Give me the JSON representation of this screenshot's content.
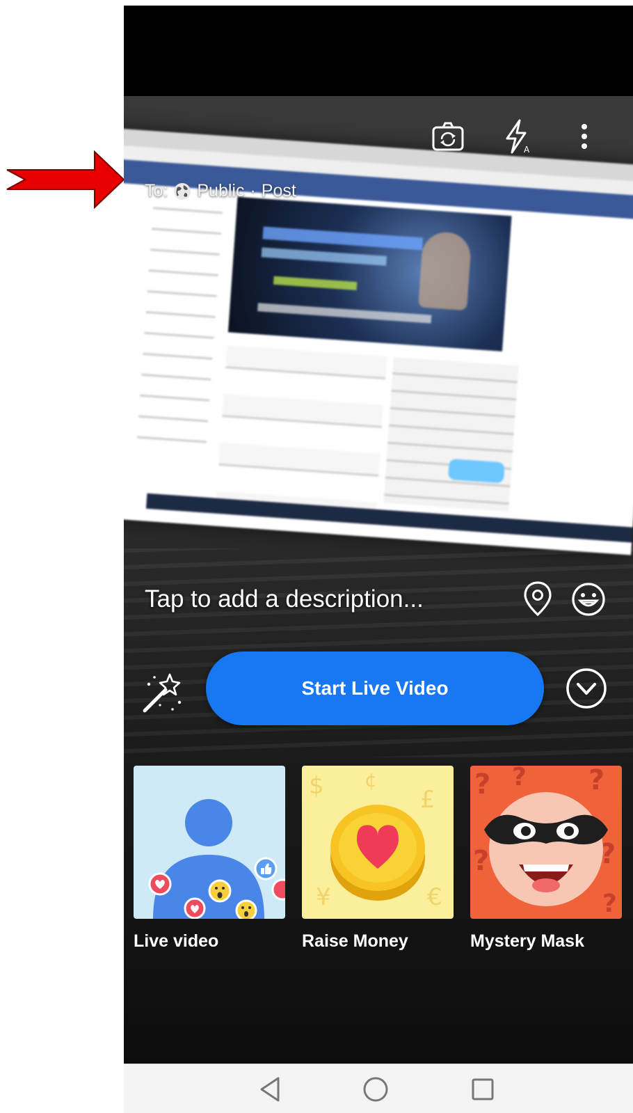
{
  "audience": {
    "to_label": "To:",
    "privacy": "Public",
    "separator": "·",
    "post_type": "Post",
    "icon": "globe-icon"
  },
  "camera_controls": {
    "icons": [
      "flip-camera-icon",
      "flash-icon",
      "more-vertical-icon"
    ]
  },
  "composer": {
    "description_placeholder": "Tap to add a description...",
    "location_icon": "location-pin-icon",
    "feeling_icon": "smiley-icon"
  },
  "actions": {
    "effects_icon": "magic-wand-icon",
    "start_label": "Start Live Video",
    "expand_icon": "chevron-down-circle-icon"
  },
  "formats": [
    {
      "label": "Live video"
    },
    {
      "label": "Raise Money"
    },
    {
      "label": "Mystery Mask"
    }
  ],
  "nav_bar": {
    "icons": [
      "back-icon",
      "home-icon",
      "recent-apps-icon"
    ]
  },
  "colors": {
    "button_blue": "#1877f2",
    "annotation_red": "#e60000"
  }
}
